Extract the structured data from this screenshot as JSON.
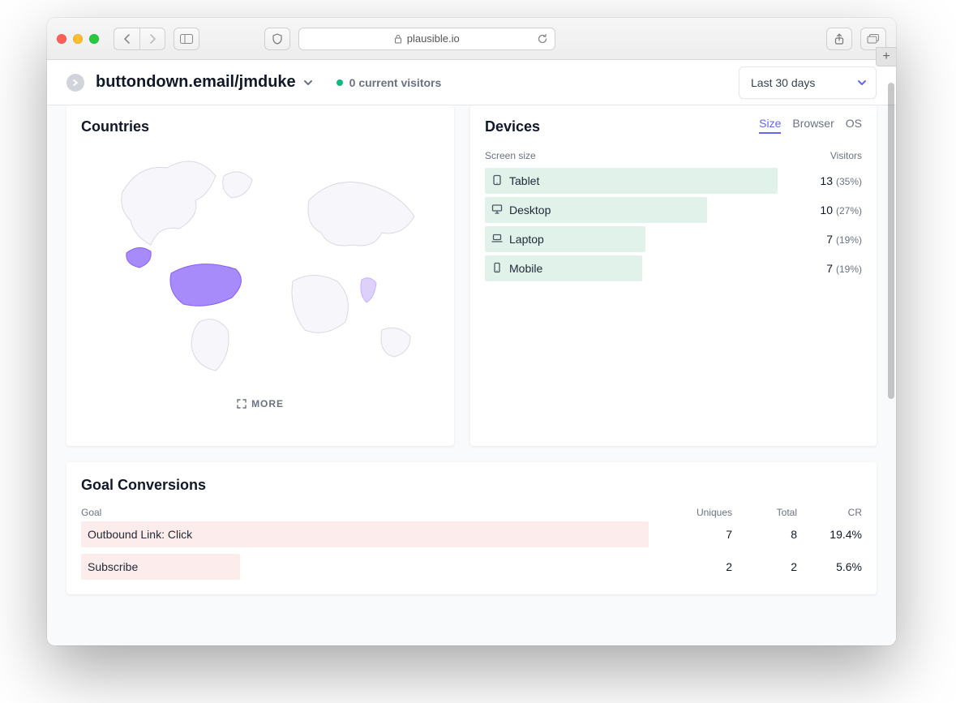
{
  "browser": {
    "url_host": "plausible.io",
    "lock_label": "lock-icon"
  },
  "header": {
    "site": "buttondown.email/jmduke",
    "visitors_text": "0 current visitors",
    "date_range": "Last 30 days"
  },
  "countries": {
    "title": "Countries",
    "more": "MORE"
  },
  "devices": {
    "title": "Devices",
    "tabs": {
      "size": "Size",
      "browser": "Browser",
      "os": "OS"
    },
    "col_left": "Screen size",
    "col_right": "Visitors",
    "rows": [
      {
        "label": "Tablet",
        "visitors": 13,
        "pct": "(35%)",
        "bar_pct": 95,
        "icon": "tablet"
      },
      {
        "label": "Desktop",
        "visitors": 10,
        "pct": "(27%)",
        "bar_pct": 72,
        "icon": "desktop"
      },
      {
        "label": "Laptop",
        "visitors": 7,
        "pct": "(19%)",
        "bar_pct": 52,
        "icon": "laptop"
      },
      {
        "label": "Mobile",
        "visitors": 7,
        "pct": "(19%)",
        "bar_pct": 51,
        "icon": "mobile"
      }
    ]
  },
  "goals": {
    "title": "Goal Conversions",
    "cols": {
      "goal": "Goal",
      "uniques": "Uniques",
      "total": "Total",
      "cr": "CR"
    },
    "rows": [
      {
        "label": "Outbound Link: Click",
        "uniques": 7,
        "total": 8,
        "cr": "19.4%",
        "bar_pct": 100
      },
      {
        "label": "Subscribe",
        "uniques": 2,
        "total": 2,
        "cr": "5.6%",
        "bar_pct": 28
      }
    ]
  },
  "chart_data": [
    {
      "type": "bar",
      "title": "Devices – Screen size",
      "categories": [
        "Tablet",
        "Desktop",
        "Laptop",
        "Mobile"
      ],
      "series": [
        {
          "name": "Visitors",
          "values": [
            13,
            10,
            7,
            7
          ]
        }
      ],
      "percent": [
        35,
        27,
        19,
        19
      ],
      "orientation": "horizontal"
    },
    {
      "type": "bar",
      "title": "Goal Conversions",
      "categories": [
        "Outbound Link: Click",
        "Subscribe"
      ],
      "series": [
        {
          "name": "Uniques",
          "values": [
            7,
            2
          ]
        },
        {
          "name": "Total",
          "values": [
            8,
            2
          ]
        },
        {
          "name": "CR (%)",
          "values": [
            19.4,
            5.6
          ]
        }
      ],
      "orientation": "horizontal"
    },
    {
      "type": "map",
      "title": "Countries",
      "highlighted": [
        "United States",
        "India"
      ]
    }
  ]
}
